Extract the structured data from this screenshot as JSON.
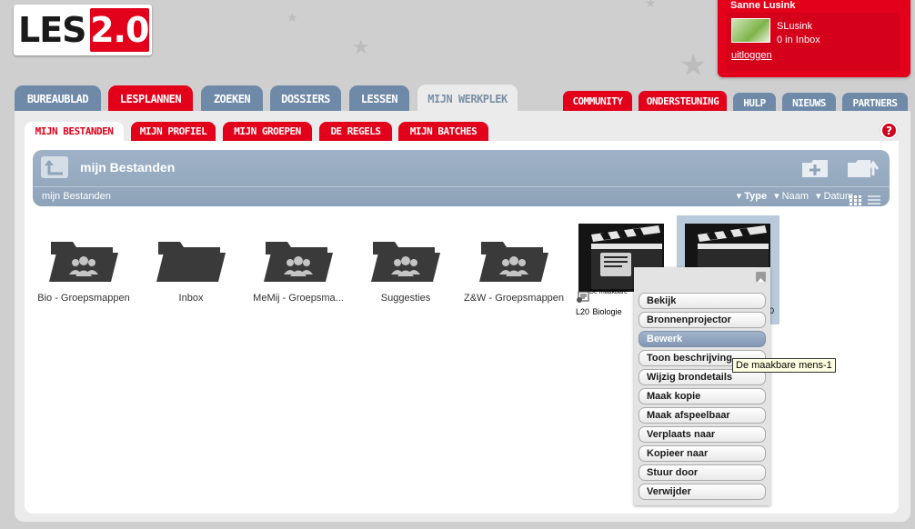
{
  "logo": {
    "text": "LES",
    "version": "2.0"
  },
  "user": {
    "name": "Sanne Lusink",
    "login": "SLusink",
    "inbox": "0 in Inbox",
    "logout": "uitloggen"
  },
  "main_tabs": [
    {
      "label": "BUREAUBLAD"
    },
    {
      "label": "LESPLANNEN"
    },
    {
      "label": "ZOEKEN"
    },
    {
      "label": "DOSSIERS"
    },
    {
      "label": "LESSEN"
    },
    {
      "label": "MIJN WERKPLEK"
    }
  ],
  "right_tabs": [
    {
      "label": "COMMUNITY"
    },
    {
      "label": "ONDERSTEUNING"
    },
    {
      "label": "HULP"
    },
    {
      "label": "NIEUWS"
    },
    {
      "label": "PARTNERS"
    }
  ],
  "sub_tabs": [
    {
      "label": "MIJN BESTANDEN"
    },
    {
      "label": "MIJN PROFIEL"
    },
    {
      "label": "MIJN GROEPEN"
    },
    {
      "label": "DE REGELS"
    },
    {
      "label": "MIJN BATCHES"
    }
  ],
  "help": "?",
  "folder_header": {
    "title": "mijn Bestanden",
    "breadcrumb": "mijn Bestanden",
    "sort_type": "Type",
    "sort_name": "Naam",
    "sort_date": "Datum"
  },
  "folders": [
    {
      "label": "Bio - Groepsmappen",
      "icon": "group-folder-icon"
    },
    {
      "label": "Inbox",
      "icon": "folder-icon"
    },
    {
      "label": "MeMij - Groepsma...",
      "icon": "group-folder-icon"
    },
    {
      "label": "Suggesties",
      "icon": "group-folder-icon"
    },
    {
      "label": "Z&W - Groepsmappen",
      "icon": "group-folder-icon"
    }
  ],
  "media_item": {
    "caption": "De maakbare",
    "meta_left": "L20",
    "meta_subject": "Biologie",
    "meta_num": "1",
    "second_num": "0"
  },
  "context_menu": [
    {
      "label": "Bekijk"
    },
    {
      "label": "Bronnenprojector"
    },
    {
      "label": "Bewerk"
    },
    {
      "label": "Toon beschrijving"
    },
    {
      "label": "Wijzig brondetails"
    },
    {
      "label": "Maak kopie"
    },
    {
      "label": "Maak afspeelbaar"
    },
    {
      "label": "Verplaats naar"
    },
    {
      "label": "Kopieer naar"
    },
    {
      "label": "Stuur door"
    },
    {
      "label": "Verwijder"
    }
  ],
  "tooltip": "De maakbare mens-1",
  "colors": {
    "brand_red": "#e2001a",
    "tab_blue": "#6f8aa9",
    "bar_blue": "#9fb2c7"
  }
}
